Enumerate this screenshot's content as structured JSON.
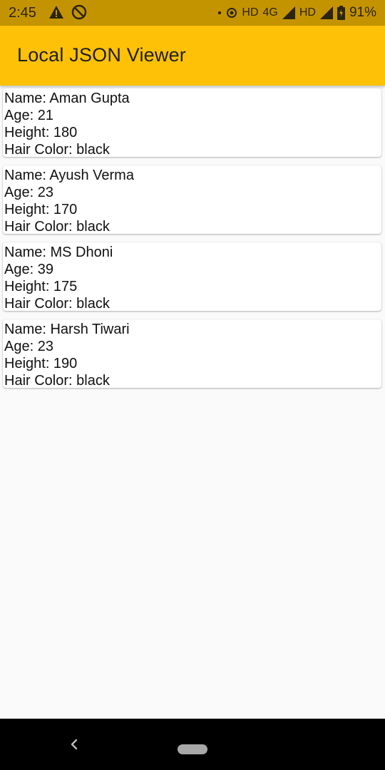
{
  "status": {
    "time": "2:45",
    "network_1": "HD",
    "network_1_type": "4G",
    "network_2": "HD",
    "battery": "91%"
  },
  "app_bar": {
    "title": "Local JSON Viewer"
  },
  "people": [
    {
      "name": "Name: Aman Gupta",
      "age": "Age: 21",
      "height": "Height: 180",
      "hair": "Hair Color: black"
    },
    {
      "name": "Name: Ayush Verma",
      "age": "Age: 23",
      "height": "Height: 170",
      "hair": "Hair Color: black"
    },
    {
      "name": "Name: MS Dhoni",
      "age": "Age: 39",
      "height": "Height: 175",
      "hair": "Hair Color: black"
    },
    {
      "name": "Name: Harsh Tiwari",
      "age": "Age: 23",
      "height": "Height: 190",
      "hair": "Hair Color: black"
    }
  ],
  "colors": {
    "status_bar": "#c49400",
    "app_bar": "#ffc107",
    "background": "#fafafa"
  }
}
